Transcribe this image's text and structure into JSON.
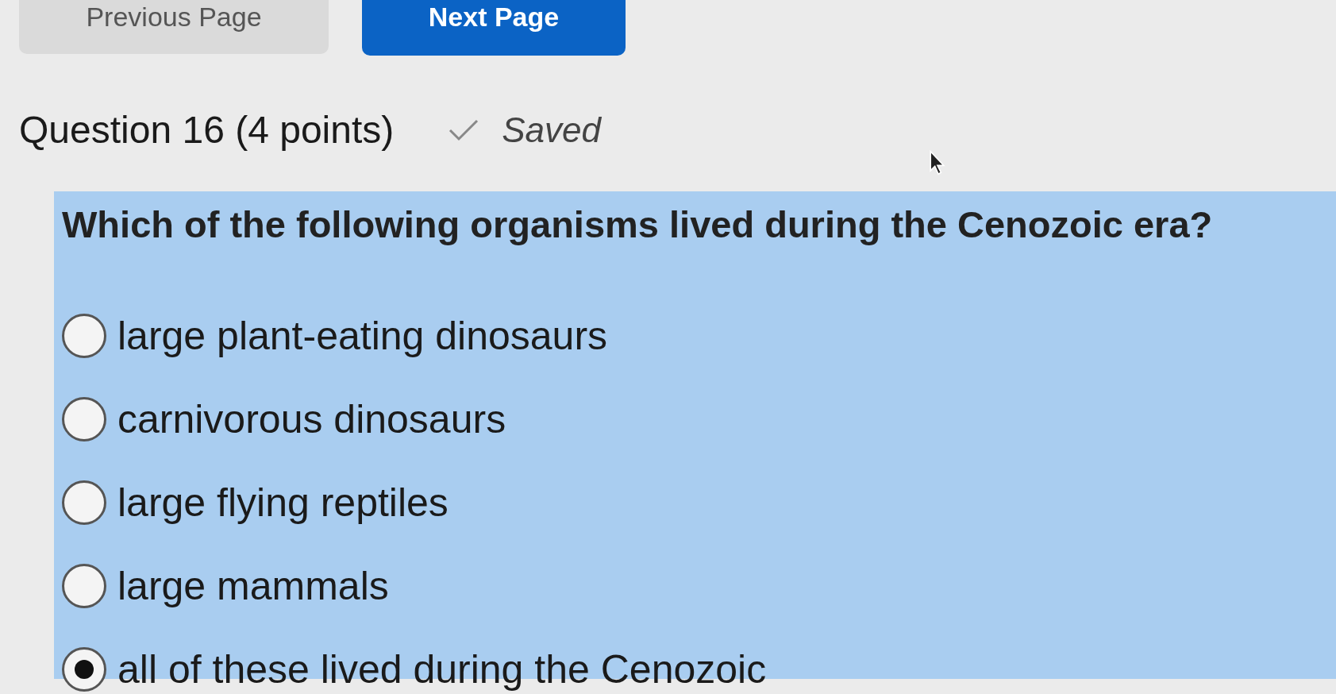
{
  "nav_buttons": [
    {
      "label": "Previous Page",
      "kind": "secondary"
    },
    {
      "label": "Next Page",
      "kind": "primary"
    }
  ],
  "question": {
    "title": "Question 16",
    "points": "(4 points)",
    "status": "Saved",
    "saved": true,
    "prompt": "Which of the following organisms lived during the Cenozoic era?"
  },
  "options": [
    {
      "label": "large plant-eating dinosaurs",
      "selected": false
    },
    {
      "label": "carnivorous dinosaurs",
      "selected": false
    },
    {
      "label": "large flying reptiles",
      "selected": false
    },
    {
      "label": "large mammals",
      "selected": false
    },
    {
      "label": "all of these lived during the Cenozoic",
      "selected": true
    }
  ]
}
